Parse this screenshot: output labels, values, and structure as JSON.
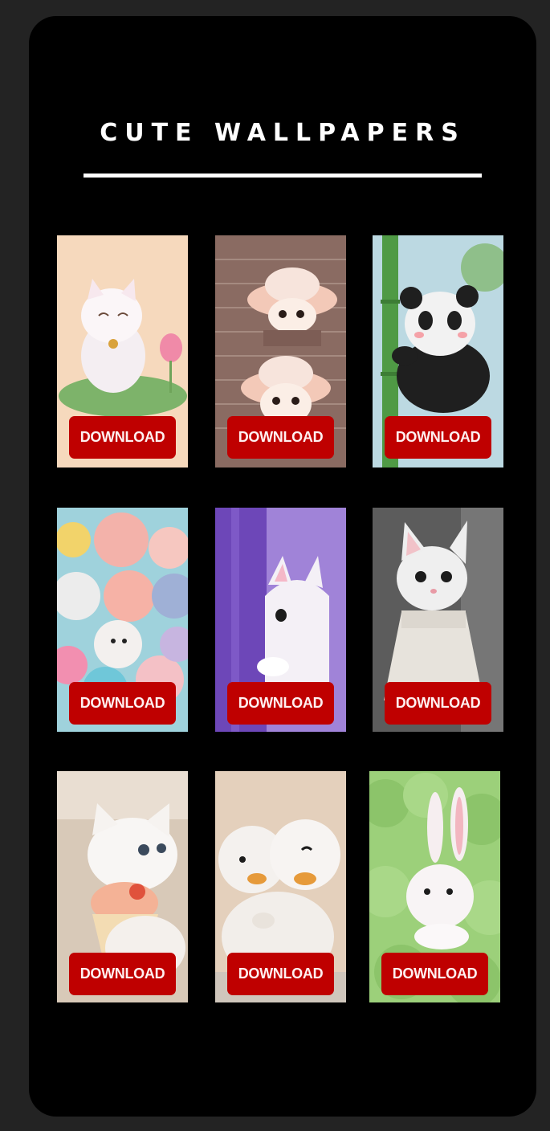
{
  "header": {
    "title": "CUTE WALLPAPERS"
  },
  "wallpapers": [
    {
      "subject": "white kitten on lotus leaf",
      "download_label": "DOWNLOAD"
    },
    {
      "subject": "two kittens in pink hats on brick wall",
      "download_label": "DOWNLOAD"
    },
    {
      "subject": "baby panda climbing bamboo",
      "download_label": "DOWNLOAD"
    },
    {
      "subject": "pile of pastel fluffy creatures",
      "download_label": "DOWNLOAD"
    },
    {
      "subject": "white cat peeking from purple wall",
      "download_label": "DOWNLOAD"
    },
    {
      "subject": "white kitten in dress",
      "download_label": "DOWNLOAD"
    },
    {
      "subject": "white kitten with cupcake",
      "download_label": "DOWNLOAD"
    },
    {
      "subject": "two fluffy white ducklings",
      "download_label": "DOWNLOAD"
    },
    {
      "subject": "white bunny on green background",
      "download_label": "DOWNLOAD"
    }
  ],
  "colors": {
    "page_background": "#232323",
    "screen_background": "#000000",
    "button_background": "#bf0000",
    "title_color": "#ffffff"
  }
}
